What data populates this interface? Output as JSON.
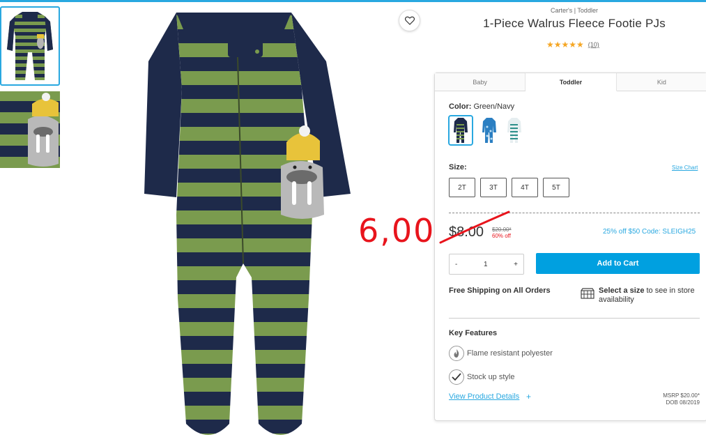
{
  "product": {
    "brand_line": "Carter's | Toddler",
    "title": "1-Piece Walrus Fleece Footie PJs",
    "stars": "★★★★★",
    "rating_value": 5,
    "review_count": "(10)"
  },
  "tabs": [
    {
      "label": "Baby",
      "active": false
    },
    {
      "label": "Toddler",
      "active": true
    },
    {
      "label": "Kid",
      "active": false
    }
  ],
  "color": {
    "label": "Color:",
    "selected": "Green/Navy",
    "swatches": [
      "green-navy",
      "blue-print",
      "white-stripe"
    ]
  },
  "size": {
    "label": "Size:",
    "chart_link": "Size Chart",
    "options": [
      "2T",
      "3T",
      "4T",
      "5T"
    ]
  },
  "pricing": {
    "price": "$8.00",
    "msrp": "$20.00*",
    "percent_off": "60% off",
    "promo": "25% off $50 Code: SLEIGH25"
  },
  "annotation": {
    "text": "6,00",
    "color": "#e8141c"
  },
  "cart": {
    "minus": "-",
    "quantity": "1",
    "plus": "+",
    "add_label": "Add to Cart"
  },
  "shipping": {
    "free_shipping": "Free Shipping on All Orders",
    "store_bold": "Select a size",
    "store_rest": " to see in store availability"
  },
  "features": {
    "title": "Key Features",
    "items": [
      {
        "icon": "flame-icon",
        "text": "Flame resistant polyester"
      },
      {
        "icon": "check-icon",
        "text": "Stock up style"
      }
    ],
    "details_link": "View Product Details",
    "details_plus": "+",
    "msrp_line": "MSRP $20.00*",
    "dob_line": "DOB 08/2019"
  },
  "colors": {
    "accent": "#29a8e0",
    "button": "#00a0e0",
    "navy": "#1e2a4a",
    "green": "#7a9b4e",
    "star": "#f5a623",
    "sale": "#e8141c"
  }
}
